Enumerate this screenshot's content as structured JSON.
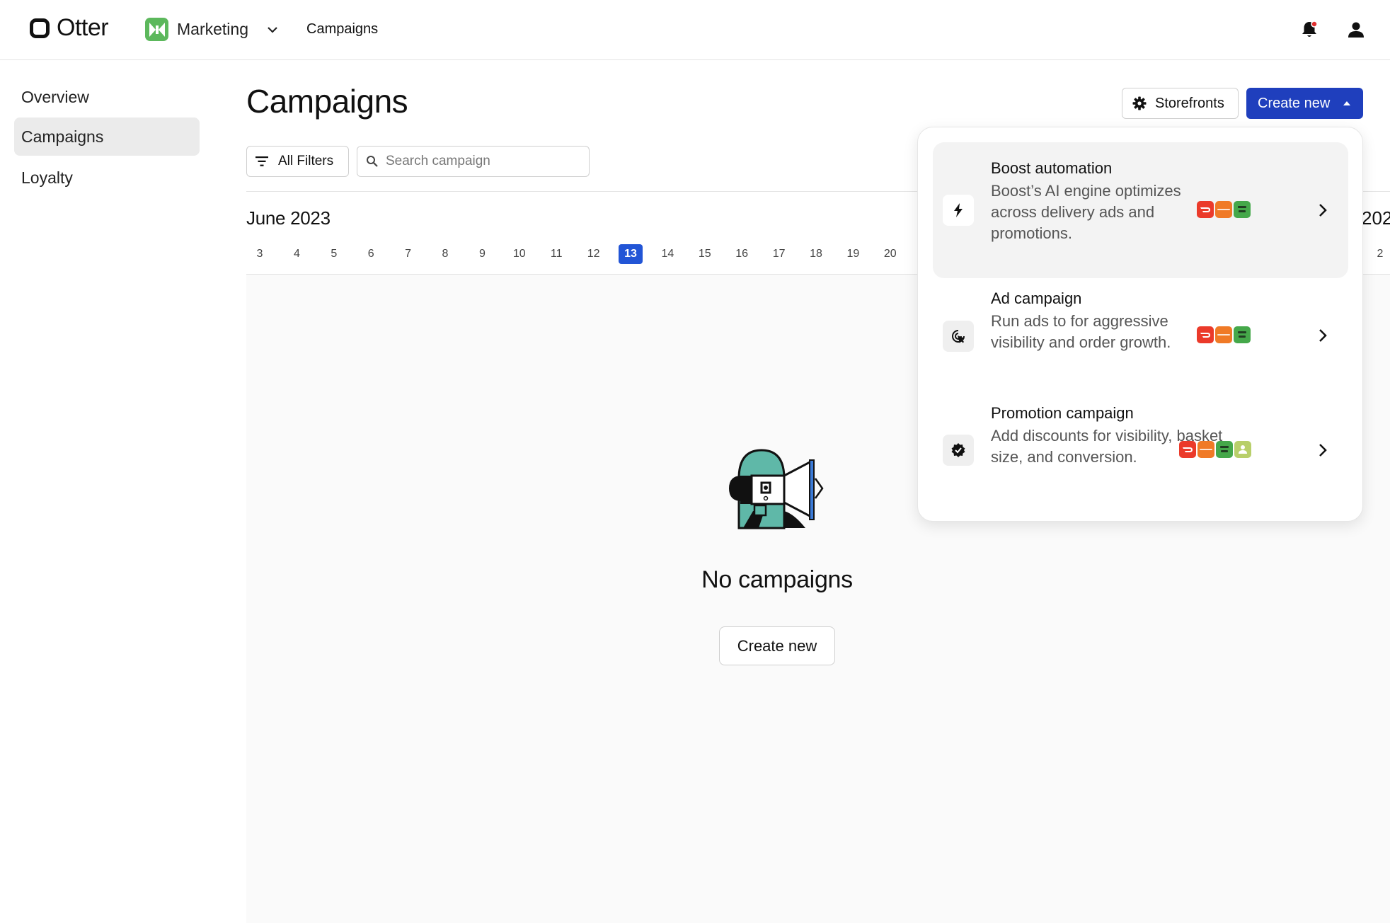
{
  "header": {
    "logo_text": "Otter",
    "app_name": "Marketing",
    "nav_label": "Campaigns"
  },
  "sidebar": {
    "items": [
      {
        "label": "Overview",
        "active": false
      },
      {
        "label": "Campaigns",
        "active": true
      },
      {
        "label": "Loyalty",
        "active": false
      }
    ]
  },
  "main": {
    "title": "Campaigns",
    "storefronts_label": "Storefronts",
    "create_new_label": "Create new",
    "filters_label": "All Filters",
    "search_placeholder": "Search campaign",
    "month_label": "June 2023",
    "next_month_partial": "202",
    "days": [
      "3",
      "4",
      "5",
      "6",
      "7",
      "8",
      "9",
      "10",
      "11",
      "12",
      "13",
      "14",
      "15",
      "16",
      "17",
      "18",
      "19",
      "20"
    ],
    "today": "13",
    "trailing_day": "2",
    "empty_title": "No campaigns",
    "empty_create_label": "Create new"
  },
  "dropdown": {
    "items": [
      {
        "title": "Boost automation",
        "description": "Boost’s AI engine optimizes across delivery ads and promotions.",
        "icon": "lightning-icon",
        "platforms": [
          "doordash",
          "grubhub",
          "uber-eats"
        ]
      },
      {
        "title": "Ad campaign",
        "description": "Run ads to for aggressive visibility and order growth.",
        "icon": "target-click-icon",
        "platforms": [
          "doordash",
          "grubhub",
          "uber-eats"
        ]
      },
      {
        "title": "Promotion campaign",
        "description": "Add discounts for visibility, basket size, and conversion.",
        "icon": "verified-badge-icon",
        "platforms": [
          "doordash",
          "grubhub",
          "uber-eats",
          "ordering"
        ]
      }
    ]
  },
  "colors": {
    "primary": "#1f3fbd",
    "today": "#2255d6",
    "app_icon": "#5cb85c",
    "notification_dot": "#e03030",
    "doordash": "#eb3a2a",
    "grubhub": "#f07a26",
    "uber_eats": "#45a84a",
    "ordering": "#b8cf6a"
  }
}
